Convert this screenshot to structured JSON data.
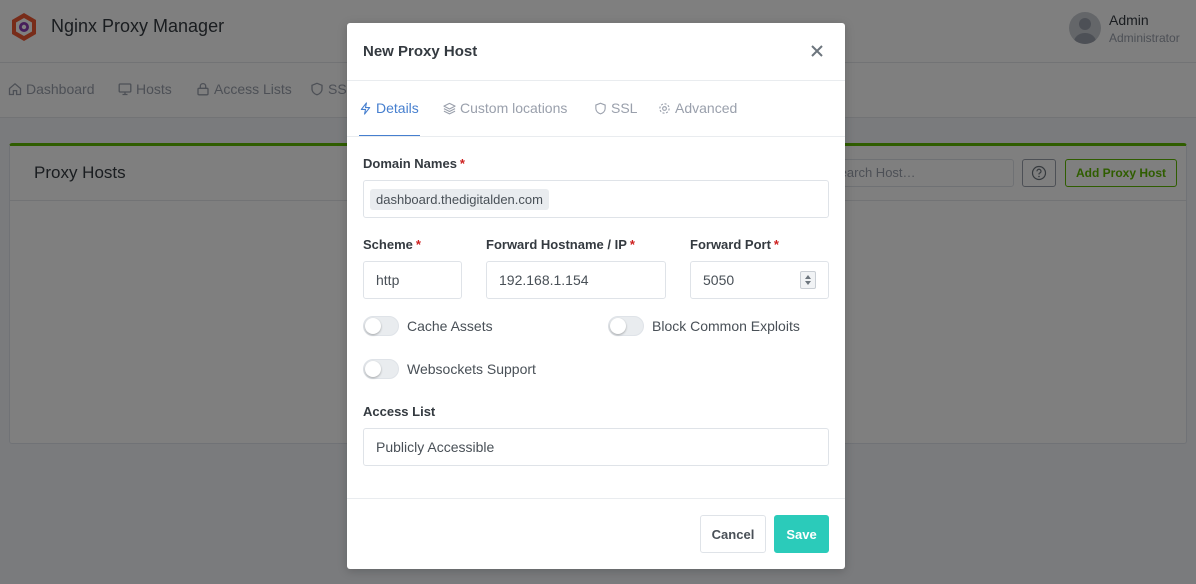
{
  "app": {
    "title": "Nginx Proxy Manager"
  },
  "user": {
    "name": "Admin",
    "role": "Administrator"
  },
  "nav": [
    {
      "label": "Dashboard",
      "icon": "home-icon"
    },
    {
      "label": "Hosts",
      "icon": "monitor-icon"
    },
    {
      "label": "Access Lists",
      "icon": "lock-icon"
    },
    {
      "label": "SSL",
      "icon": "shield-icon"
    }
  ],
  "card": {
    "title": "Proxy Hosts",
    "search_placeholder": "Search Host…",
    "add_button": "Add Proxy Host"
  },
  "modal": {
    "title": "New Proxy Host",
    "tabs": [
      {
        "label": "Details",
        "icon": "zap-icon",
        "active": true
      },
      {
        "label": "Custom locations",
        "icon": "layers-icon",
        "active": false
      },
      {
        "label": "SSL",
        "icon": "shield-icon",
        "active": false
      },
      {
        "label": "Advanced",
        "icon": "settings-icon",
        "active": false
      }
    ],
    "domain_names": {
      "label": "Domain Names",
      "values": [
        "dashboard.thedigitalden.com"
      ]
    },
    "scheme": {
      "label": "Scheme",
      "value": "http"
    },
    "forward_host": {
      "label": "Forward Hostname / IP",
      "value": "192.168.1.154"
    },
    "forward_port": {
      "label": "Forward Port",
      "value": "5050"
    },
    "toggles": {
      "cache_assets": {
        "label": "Cache Assets",
        "on": false
      },
      "block_exploits": {
        "label": "Block Common Exploits",
        "on": false
      },
      "websockets": {
        "label": "Websockets Support",
        "on": false
      }
    },
    "access_list": {
      "label": "Access List",
      "value": "Publicly Accessible"
    },
    "buttons": {
      "cancel": "Cancel",
      "save": "Save"
    },
    "required_mark": "*"
  },
  "colors": {
    "accent": "#467fcf",
    "save": "#2bcbba",
    "required": "#cd201f",
    "card_border": "#5eba00"
  }
}
